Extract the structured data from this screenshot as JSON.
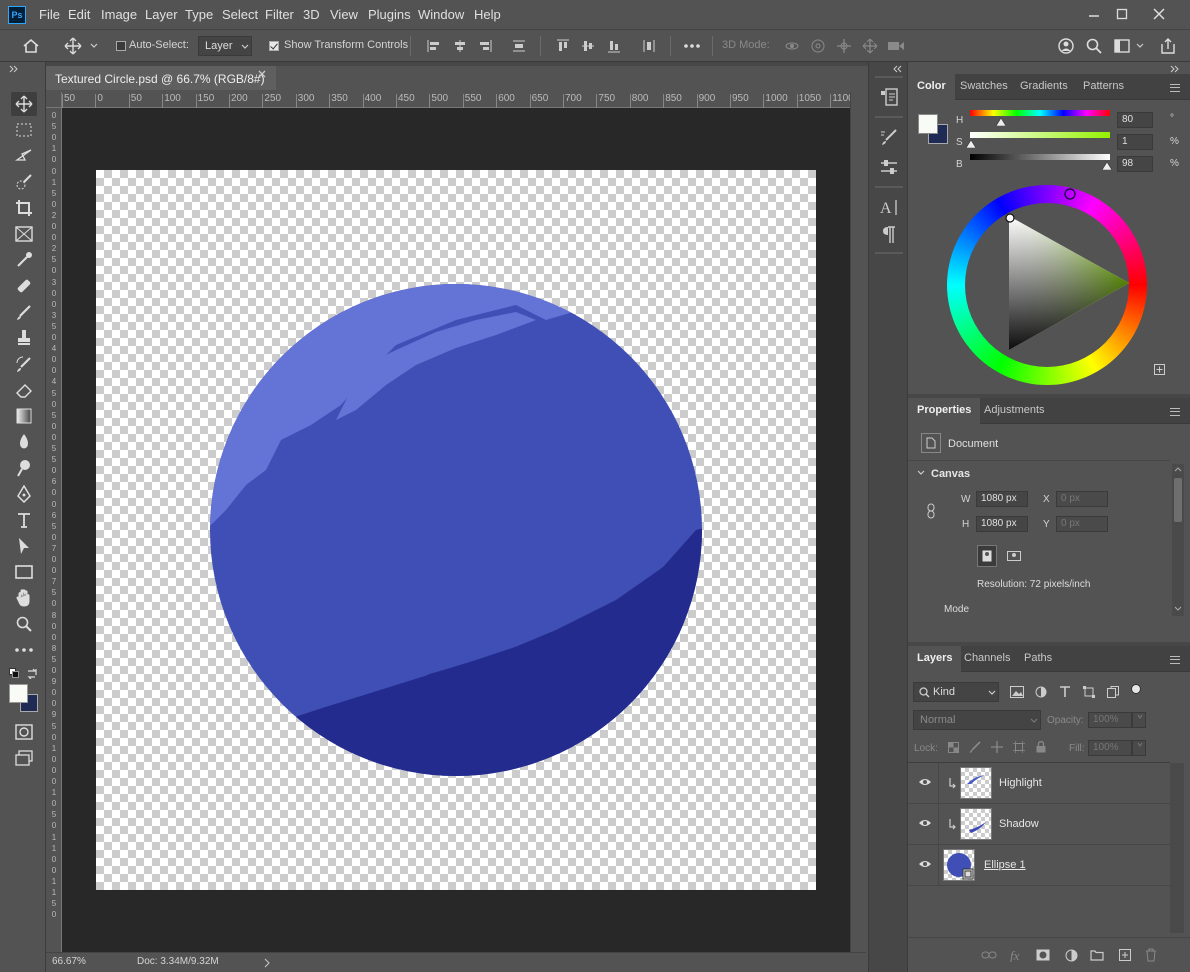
{
  "app": {
    "logo": "Ps"
  },
  "menubar": {
    "items": [
      "File",
      "Edit",
      "Image",
      "Layer",
      "Type",
      "Select",
      "Filter",
      "3D",
      "View",
      "Plugins",
      "Window",
      "Help"
    ],
    "window_controls": [
      "minimize-icon",
      "maximize-icon",
      "close-icon"
    ]
  },
  "options": {
    "auto_select_label": "Auto-Select:",
    "auto_select_checked": false,
    "target": "Layer",
    "show_transform_label": "Show Transform Controls",
    "show_transform_checked": true,
    "mode3d_label": "3D Mode:"
  },
  "document": {
    "tab_title": "Textured Circle.psd @ 66.7% (RGB/8#)",
    "ruler_h": [
      "50",
      "0",
      "50",
      "100",
      "150",
      "200",
      "250",
      "300",
      "350",
      "400",
      "450",
      "500",
      "550",
      "600",
      "650",
      "700",
      "750",
      "800",
      "850",
      "900",
      "950",
      "1000",
      "1050",
      "1100"
    ],
    "ruler_v": [
      "0",
      "5",
      "0",
      "1",
      "0",
      "0",
      "1",
      "5",
      "0",
      "2",
      "0",
      "0",
      "2",
      "5",
      "0",
      "3",
      "0",
      "0",
      "3",
      "5",
      "0",
      "4",
      "0",
      "0",
      "4",
      "5",
      "0",
      "5",
      "0",
      "0",
      "5",
      "5",
      "0",
      "6",
      "0",
      "0",
      "6",
      "5",
      "0",
      "7",
      "0",
      "0",
      "7",
      "5",
      "0",
      "8",
      "0",
      "0",
      "8",
      "5",
      "0",
      "9",
      "0",
      "0",
      "9",
      "5",
      "0",
      "1",
      "0",
      "0",
      "0",
      "1",
      "0",
      "5",
      "0",
      "1",
      "1",
      "0",
      "0",
      "1",
      "1",
      "5",
      "0"
    ],
    "status_zoom": "66.67%",
    "status_doc": "Doc: 3.34M/9.32M",
    "colors": {
      "ellipse": "#3f4fb5",
      "highlight": "#6473d6",
      "shadow": "#232c8e"
    }
  },
  "color_panel": {
    "tabs": [
      "Color",
      "Swatches",
      "Gradients",
      "Patterns"
    ],
    "active_tab": "Color",
    "h_label": "H",
    "h_value": "80",
    "h_unit": "°",
    "h_fraction": 0.22,
    "s_label": "S",
    "s_value": "1",
    "s_unit": "%",
    "s_fraction": 0.01,
    "b_label": "B",
    "b_value": "98",
    "b_unit": "%",
    "b_fraction": 0.98,
    "foreground": "#f9fbf6",
    "background": "#1f2a55"
  },
  "properties_panel": {
    "tabs": [
      "Properties",
      "Adjustments"
    ],
    "active_tab": "Properties",
    "doc_label": "Document",
    "canvas_label": "Canvas",
    "w_label": "W",
    "w_value": "1080 px",
    "h_label": "H",
    "h_value": "1080 px",
    "x_label": "X",
    "x_placeholder": "0 px",
    "y_label": "Y",
    "y_placeholder": "0 px",
    "resolution": "Resolution: 72 pixels/inch",
    "mode_label": "Mode"
  },
  "layers_panel": {
    "tabs": [
      "Layers",
      "Channels",
      "Paths"
    ],
    "active_tab": "Layers",
    "filter_kind": "Kind",
    "blend_mode": "Normal",
    "opacity_label": "Opacity:",
    "opacity_value": "100%",
    "lock_label": "Lock:",
    "fill_label": "Fill:",
    "fill_value": "100%",
    "layers": [
      {
        "name": "Highlight",
        "clipped": true,
        "visible": true
      },
      {
        "name": "Shadow",
        "clipped": true,
        "visible": true
      },
      {
        "name": "Ellipse 1",
        "clipped": false,
        "visible": true
      }
    ]
  }
}
